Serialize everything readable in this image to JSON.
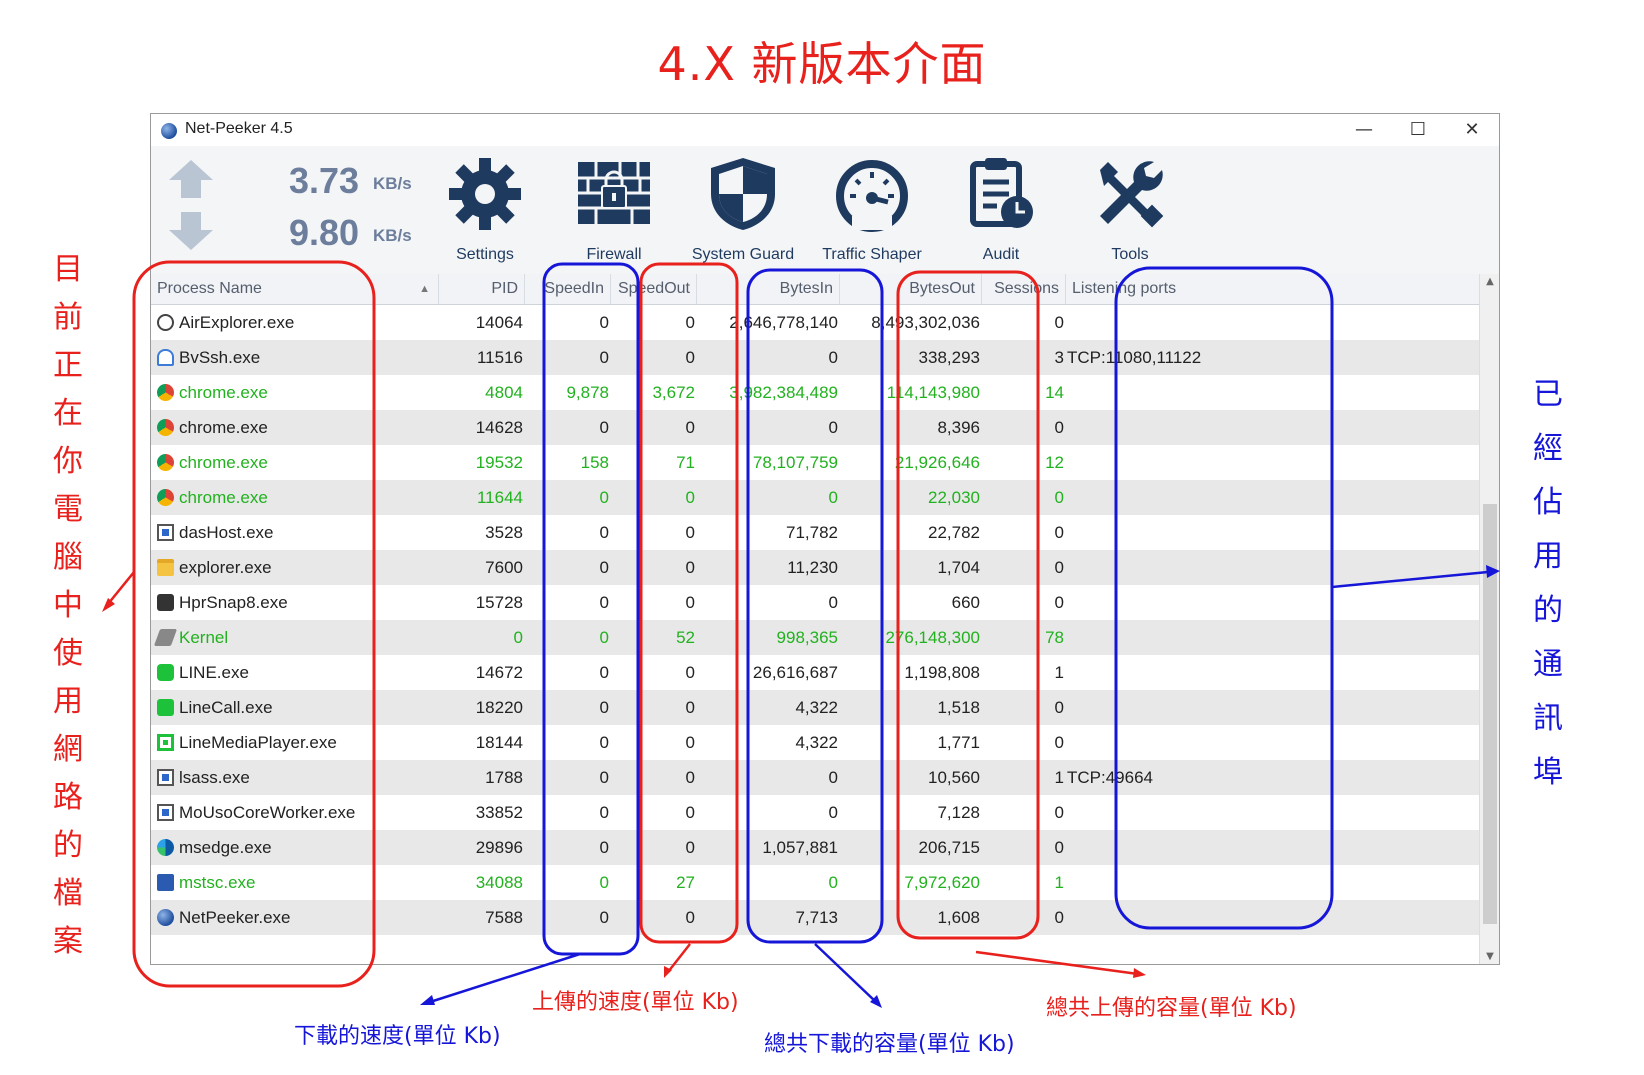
{
  "page_title": "4.X 新版本介面",
  "window": {
    "title": "Net-Peeker 4.5",
    "minimize": "—",
    "maximize": "☐",
    "close": "✕"
  },
  "speeds": {
    "up_value": "3.73",
    "up_unit": "KB/s",
    "down_value": "9.80",
    "down_unit": "KB/s"
  },
  "toolbar": [
    {
      "label": "Settings",
      "icon": "gear-icon"
    },
    {
      "label": "Firewall",
      "icon": "firewall-icon"
    },
    {
      "label": "System Guard",
      "icon": "shield-icon"
    },
    {
      "label": "Traffic Shaper",
      "icon": "speedometer-icon"
    },
    {
      "label": "Audit",
      "icon": "clipboard-clock-icon"
    },
    {
      "label": "Tools",
      "icon": "wrench-screwdriver-icon"
    }
  ],
  "columns": {
    "process_name": "Process Name",
    "pid": "PID",
    "speed_in": "SpeedIn",
    "speed_out": "SpeedOut",
    "bytes_in": "BytesIn",
    "bytes_out": "BytesOut",
    "sessions": "Sessions",
    "listening_ports": "Listening ports",
    "sort_indicator": "▲"
  },
  "rows": [
    {
      "name": "AirExplorer.exe",
      "pid": "14064",
      "speed_in": "0",
      "speed_out": "0",
      "bytes_in": "2,646,778,140",
      "bytes_out": "8,493,302,036",
      "sessions": "0",
      "ports": "",
      "active": false,
      "icon": "airexplorer-icon"
    },
    {
      "name": "BvSsh.exe",
      "pid": "11516",
      "speed_in": "0",
      "speed_out": "0",
      "bytes_in": "0",
      "bytes_out": "338,293",
      "sessions": "3",
      "ports": "TCP:11080,11122",
      "active": false,
      "icon": "bvssh-icon"
    },
    {
      "name": "chrome.exe",
      "pid": "4804",
      "speed_in": "9,878",
      "speed_out": "3,672",
      "bytes_in": "3,982,384,489",
      "bytes_out": "114,143,980",
      "sessions": "14",
      "ports": "",
      "active": true,
      "icon": "chrome-icon"
    },
    {
      "name": "chrome.exe",
      "pid": "14628",
      "speed_in": "0",
      "speed_out": "0",
      "bytes_in": "0",
      "bytes_out": "8,396",
      "sessions": "0",
      "ports": "",
      "active": false,
      "icon": "chrome-icon"
    },
    {
      "name": "chrome.exe",
      "pid": "19532",
      "speed_in": "158",
      "speed_out": "71",
      "bytes_in": "78,107,759",
      "bytes_out": "21,926,646",
      "sessions": "12",
      "ports": "",
      "active": true,
      "icon": "chrome-icon"
    },
    {
      "name": "chrome.exe",
      "pid": "11644",
      "speed_in": "0",
      "speed_out": "0",
      "bytes_in": "0",
      "bytes_out": "22,030",
      "sessions": "0",
      "ports": "",
      "active": true,
      "icon": "chrome-icon"
    },
    {
      "name": "dasHost.exe",
      "pid": "3528",
      "speed_in": "0",
      "speed_out": "0",
      "bytes_in": "71,782",
      "bytes_out": "22,782",
      "sessions": "0",
      "ports": "",
      "active": false,
      "icon": "window-icon"
    },
    {
      "name": "explorer.exe",
      "pid": "7600",
      "speed_in": "0",
      "speed_out": "0",
      "bytes_in": "11,230",
      "bytes_out": "1,704",
      "sessions": "0",
      "ports": "",
      "active": false,
      "icon": "folder-icon"
    },
    {
      "name": "HprSnap8.exe",
      "pid": "15728",
      "speed_in": "0",
      "speed_out": "0",
      "bytes_in": "0",
      "bytes_out": "660",
      "sessions": "0",
      "ports": "",
      "active": false,
      "icon": "camera-icon"
    },
    {
      "name": "Kernel",
      "pid": "0",
      "speed_in": "0",
      "speed_out": "52",
      "bytes_in": "998,365",
      "bytes_out": "276,148,300",
      "sessions": "78",
      "ports": "",
      "active": true,
      "icon": "chip-icon"
    },
    {
      "name": "LINE.exe",
      "pid": "14672",
      "speed_in": "0",
      "speed_out": "0",
      "bytes_in": "26,616,687",
      "bytes_out": "1,198,808",
      "sessions": "1",
      "ports": "",
      "active": false,
      "icon": "line-icon"
    },
    {
      "name": "LineCall.exe",
      "pid": "18220",
      "speed_in": "0",
      "speed_out": "0",
      "bytes_in": "4,322",
      "bytes_out": "1,518",
      "sessions": "0",
      "ports": "",
      "active": false,
      "icon": "phone-icon"
    },
    {
      "name": "LineMediaPlayer.exe",
      "pid": "18144",
      "speed_in": "0",
      "speed_out": "0",
      "bytes_in": "4,322",
      "bytes_out": "1,771",
      "sessions": "0",
      "ports": "",
      "active": false,
      "icon": "media-player-icon"
    },
    {
      "name": "lsass.exe",
      "pid": "1788",
      "speed_in": "0",
      "speed_out": "0",
      "bytes_in": "0",
      "bytes_out": "10,560",
      "sessions": "1",
      "ports": "TCP:49664",
      "active": false,
      "icon": "window-icon"
    },
    {
      "name": "MoUsoCoreWorker.exe",
      "pid": "33852",
      "speed_in": "0",
      "speed_out": "0",
      "bytes_in": "0",
      "bytes_out": "7,128",
      "sessions": "0",
      "ports": "",
      "active": false,
      "icon": "window-icon"
    },
    {
      "name": "msedge.exe",
      "pid": "29896",
      "speed_in": "0",
      "speed_out": "0",
      "bytes_in": "1,057,881",
      "bytes_out": "206,715",
      "sessions": "0",
      "ports": "",
      "active": false,
      "icon": "edge-icon"
    },
    {
      "name": "mstsc.exe",
      "pid": "34088",
      "speed_in": "0",
      "speed_out": "27",
      "bytes_in": "0",
      "bytes_out": "7,972,620",
      "sessions": "1",
      "ports": "",
      "active": true,
      "icon": "remote-desktop-icon"
    },
    {
      "name": "NetPeeker.exe",
      "pid": "7588",
      "speed_in": "0",
      "speed_out": "0",
      "bytes_in": "7,713",
      "bytes_out": "1,608",
      "sessions": "0",
      "ports": "",
      "active": false,
      "icon": "netpeeker-icon"
    }
  ],
  "annotations": {
    "left_vertical": "目前正在你電腦中使用網路的檔案",
    "right_vertical": "已經佔用的通訊埠",
    "download_speed": "下載的速度(單位 Kb)",
    "upload_speed": "上傳的速度(單位 Kb)",
    "total_download": "總共下載的容量(單位 Kb)",
    "total_upload": "總共上傳的容量(單位 Kb)"
  },
  "colors": {
    "annotation_red": "#e8211d",
    "annotation_blue": "#1616d8",
    "active_green": "#22b21f",
    "toolbar_icon": "#1f3a5f"
  }
}
